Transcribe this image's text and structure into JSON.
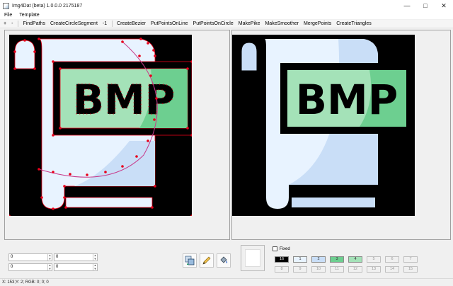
{
  "window": {
    "title": "Img4Dat (beta) 1.0.0.0 2175187",
    "controls": [
      "minimize-icon",
      "maximize-icon",
      "close-icon"
    ]
  },
  "menu": [
    "File",
    "Template"
  ],
  "toolbar": {
    "plus": "+",
    "minus": "-",
    "items": [
      "FindPaths",
      "CreateCircleSegment",
      "-1",
      "CreateBezier",
      "PutPointsOnLine",
      "PutPointsOnCircle",
      "MakePike",
      "MakeSmoother",
      "MergePoints",
      "CreateTriangles"
    ]
  },
  "canvas": {
    "image_text": "BMP",
    "colors": {
      "background": "#000000",
      "scroll": "#e8f3ff",
      "scroll_shadow": "#c9def7",
      "label_green": "#a4e2b8",
      "label_green_dark": "#6dcf90",
      "outline": "#000000",
      "points": "#e8001a",
      "curve": "#c83a8a"
    }
  },
  "inputs": [
    {
      "value": "0"
    },
    {
      "value": "0"
    },
    {
      "value": "0"
    },
    {
      "value": "0"
    }
  ],
  "tools": [
    "image-swap-icon",
    "pencil-icon",
    "paint-bucket-icon"
  ],
  "fixed_label": "Fixed",
  "palette": [
    {
      "label": "16",
      "bg": "#000000",
      "fg": "#ffffff"
    },
    {
      "label": "1",
      "bg": "#e8f3ff",
      "fg": "#333333"
    },
    {
      "label": "2",
      "bg": "#c9def7",
      "fg": "#333333"
    },
    {
      "label": "3",
      "bg": "#6dcf90",
      "fg": "#333333"
    },
    {
      "label": "4",
      "bg": "#a4e2b8",
      "fg": "#333333"
    },
    {
      "label": "5"
    },
    {
      "label": "6"
    },
    {
      "label": "7"
    },
    {
      "label": "8"
    },
    {
      "label": "9"
    },
    {
      "label": "10"
    },
    {
      "label": "11"
    },
    {
      "label": "12"
    },
    {
      "label": "13"
    },
    {
      "label": "14"
    },
    {
      "label": "15"
    }
  ],
  "status": "X: 153;Y: 2; RGB: 0; 0; 0"
}
